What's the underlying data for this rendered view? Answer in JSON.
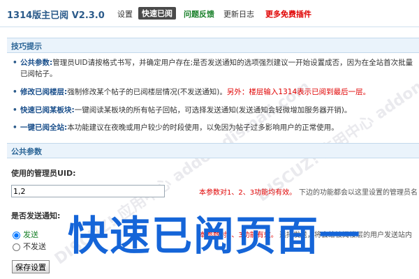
{
  "app": {
    "title": "1314版主已阅 V2.3.0"
  },
  "nav": {
    "items": [
      {
        "label": "设置"
      },
      {
        "label": "快速已阅"
      },
      {
        "label": "问题反馈"
      },
      {
        "label": "更新日志"
      },
      {
        "label": "更多免费插件"
      }
    ]
  },
  "tips": {
    "header": "技巧提示",
    "items": [
      {
        "term": "公共参数:",
        "text": "管理员UID请按格式书写，并确定用户存在;是否发送通知的选项强烈建议一开始设置成否，因为在全站首次批量已阅帖子。"
      },
      {
        "term": "修改已阅楼层:",
        "text": "强制修改某个帖子的已阅楼层情况(不发送通知)。",
        "warn": "另外：楼层输入1314表示已阅到最后一层。"
      },
      {
        "term": "快速已阅某板块:",
        "text": "一键阅读某板块的所有帖子回帖，可选择发送通知(发送通知会轻微增加服务器开销)。"
      },
      {
        "term": "一键已阅全站:",
        "text": "本功能建议在夜晚或用户较少的时段使用，以免因为帖子过多影响用户的正常使用。"
      }
    ]
  },
  "common": {
    "header": "公共参数",
    "uid_label": "使用的管理员UID:",
    "uid_value": "1,2",
    "uid_hint_red": "本参数对1、2、3功能均有效。",
    "uid_hint_grey": "下边的功能都会以这里设置的管理员名",
    "notify_label": "是否发送通知:",
    "notify_options": [
      {
        "label": "发送",
        "selected": true
      },
      {
        "label": "不发送",
        "selected": false
      }
    ],
    "notify_hint_red": "本参数对1、3功能有效。",
    "notify_hint_grey": "选择发送，将会给被阅楼层的用户发送站内",
    "save_label": "保存设置"
  },
  "overlay": {
    "text": "快速已阅页面一"
  },
  "watermark": {
    "text": "DISCUZ! 应用中心 addon.dismall.com"
  }
}
